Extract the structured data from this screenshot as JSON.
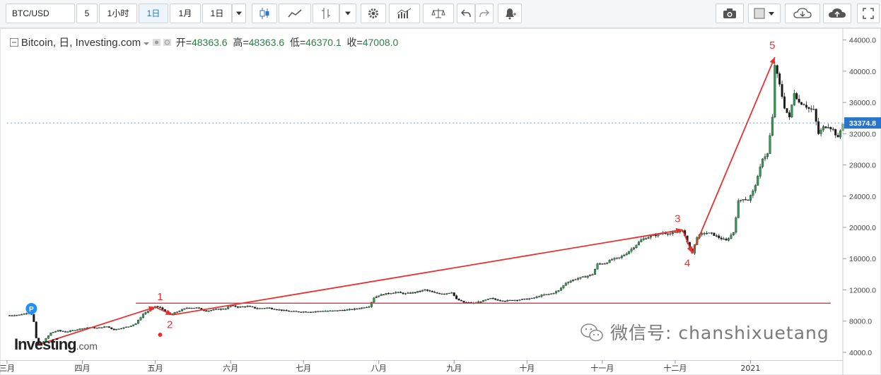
{
  "toolbar": {
    "symbol": "BTC/USD",
    "interval_input": "5",
    "intervals": [
      "1小时",
      "1日",
      "1月",
      "1日"
    ],
    "active_interval": "1日"
  },
  "legend": {
    "name": "Bitcoin, 日, Investing.com",
    "open_label": "开",
    "open": "48363.6",
    "high_label": "高",
    "high": "48363.6",
    "low_label": "低",
    "low": "46370.1",
    "close_label": "收",
    "close": "47008.0"
  },
  "watermark": {
    "wechat": "微信号: chanshixuetang",
    "logo": "Investing",
    "logo_suffix": ".com"
  },
  "colors": {
    "up": "#2e9e52",
    "down": "#1a1a1a",
    "annotation": "#e8312f",
    "price_tag": "#2a74c9"
  },
  "chart_data": {
    "type": "candlestick",
    "title": "Bitcoin, 日, Investing.com",
    "price_axis": {
      "range": [
        3000,
        45500
      ],
      "ticks": [
        4000,
        8000,
        12000,
        16000,
        20000,
        24000,
        28000,
        32000,
        36000,
        40000,
        44000
      ],
      "position": "right"
    },
    "x_axis": {
      "months": [
        "三月",
        "四月",
        "五月",
        "六月",
        "七月",
        "八月",
        "九月",
        "十月",
        "十一月",
        "十二月",
        "2021"
      ],
      "ticks_days": [
        0,
        31,
        61,
        92,
        122,
        153,
        184,
        214,
        245,
        275,
        306
      ],
      "days_visible": 344
    },
    "last_price": "33374.8",
    "trend_lines": [
      {
        "from": {
          "day": 13,
          "price": 5000
        },
        "to": {
          "day": 61,
          "price": 9800
        }
      },
      {
        "from": {
          "day": 61,
          "price": 9800
        },
        "to": {
          "day": 68,
          "price": 8800
        }
      },
      {
        "from": {
          "day": 68,
          "price": 8800
        },
        "to": {
          "day": 278,
          "price": 19700
        }
      },
      {
        "from": {
          "day": 278,
          "price": 19700
        },
        "to": {
          "day": 282,
          "price": 16700
        }
      },
      {
        "from": {
          "day": 282,
          "price": 16700
        },
        "to": {
          "day": 316,
          "price": 41800
        }
      }
    ],
    "horizontal_lines": [
      {
        "price": 10300,
        "from_day": 53,
        "to_day": 339
      }
    ],
    "labels": [
      {
        "text": "1",
        "day": 63,
        "price": 10700
      },
      {
        "text": "2",
        "day": 67,
        "price": 7100
      },
      {
        "text": "3",
        "day": 276,
        "price": 20700
      },
      {
        "text": "4",
        "day": 280,
        "price": 15000
      },
      {
        "text": "5",
        "day": 315,
        "price": 42900
      }
    ],
    "markers": [
      {
        "type": "dot",
        "day": 63,
        "price": 6250
      },
      {
        "type": "badge",
        "text": "P",
        "day": 10,
        "price": 9600
      }
    ],
    "close_series": [
      [
        0,
        8700
      ],
      [
        5,
        8800
      ],
      [
        9,
        9100
      ],
      [
        10,
        8900
      ],
      [
        11,
        7900
      ],
      [
        12,
        5800
      ],
      [
        13,
        4950
      ],
      [
        15,
        5400
      ],
      [
        18,
        6500
      ],
      [
        21,
        6800
      ],
      [
        24,
        6600
      ],
      [
        27,
        6800
      ],
      [
        30,
        7000
      ],
      [
        34,
        7200
      ],
      [
        37,
        7100
      ],
      [
        41,
        7300
      ],
      [
        44,
        6900
      ],
      [
        47,
        7100
      ],
      [
        50,
        7300
      ],
      [
        53,
        7700
      ],
      [
        56,
        8900
      ],
      [
        59,
        9500
      ],
      [
        61,
        9900
      ],
      [
        63,
        9700
      ],
      [
        65,
        9300
      ],
      [
        67,
        8800
      ],
      [
        70,
        9200
      ],
      [
        74,
        9700
      ],
      [
        78,
        9700
      ],
      [
        82,
        9300
      ],
      [
        86,
        9500
      ],
      [
        90,
        9600
      ],
      [
        92,
        10000
      ],
      [
        95,
        9800
      ],
      [
        99,
        9900
      ],
      [
        103,
        9600
      ],
      [
        107,
        9700
      ],
      [
        111,
        9500
      ],
      [
        115,
        9300
      ],
      [
        119,
        9200
      ],
      [
        122,
        9200
      ],
      [
        126,
        9200
      ],
      [
        130,
        9300
      ],
      [
        134,
        9300
      ],
      [
        138,
        9400
      ],
      [
        142,
        9500
      ],
      [
        146,
        9700
      ],
      [
        149,
        9900
      ],
      [
        151,
        11000
      ],
      [
        153,
        11300
      ],
      [
        156,
        11500
      ],
      [
        160,
        11700
      ],
      [
        164,
        11500
      ],
      [
        168,
        11700
      ],
      [
        172,
        12000
      ],
      [
        176,
        11600
      ],
      [
        180,
        11500
      ],
      [
        183,
        11700
      ],
      [
        185,
        10800
      ],
      [
        188,
        10400
      ],
      [
        192,
        10300
      ],
      [
        196,
        10600
      ],
      [
        199,
        10900
      ],
      [
        202,
        10700
      ],
      [
        205,
        10600
      ],
      [
        209,
        10700
      ],
      [
        213,
        10800
      ],
      [
        216,
        10900
      ],
      [
        220,
        11300
      ],
      [
        224,
        11500
      ],
      [
        227,
        11900
      ],
      [
        230,
        12900
      ],
      [
        234,
        13400
      ],
      [
        238,
        13700
      ],
      [
        241,
        14000
      ],
      [
        243,
        15300
      ],
      [
        246,
        15400
      ],
      [
        249,
        15900
      ],
      [
        252,
        16100
      ],
      [
        255,
        16700
      ],
      [
        258,
        17500
      ],
      [
        261,
        18400
      ],
      [
        264,
        18800
      ],
      [
        267,
        19000
      ],
      [
        270,
        19300
      ],
      [
        273,
        19200
      ],
      [
        276,
        19400
      ],
      [
        278,
        19700
      ],
      [
        280,
        18000
      ],
      [
        282,
        16700
      ],
      [
        284,
        18800
      ],
      [
        287,
        19300
      ],
      [
        290,
        19200
      ],
      [
        293,
        18700
      ],
      [
        296,
        18300
      ],
      [
        299,
        19400
      ],
      [
        301,
        23300
      ],
      [
        303,
        23700
      ],
      [
        305,
        23500
      ],
      [
        307,
        24600
      ],
      [
        309,
        26400
      ],
      [
        311,
        28900
      ],
      [
        313,
        29400
      ],
      [
        315,
        34000
      ],
      [
        316,
        40800
      ],
      [
        318,
        38200
      ],
      [
        320,
        35400
      ],
      [
        322,
        34000
      ],
      [
        324,
        37300
      ],
      [
        326,
        36000
      ],
      [
        328,
        35800
      ],
      [
        330,
        35200
      ],
      [
        332,
        35000
      ],
      [
        334,
        32000
      ],
      [
        336,
        32800
      ],
      [
        338,
        33000
      ],
      [
        340,
        32500
      ],
      [
        342,
        31400
      ],
      [
        344,
        33374.8
      ]
    ]
  }
}
